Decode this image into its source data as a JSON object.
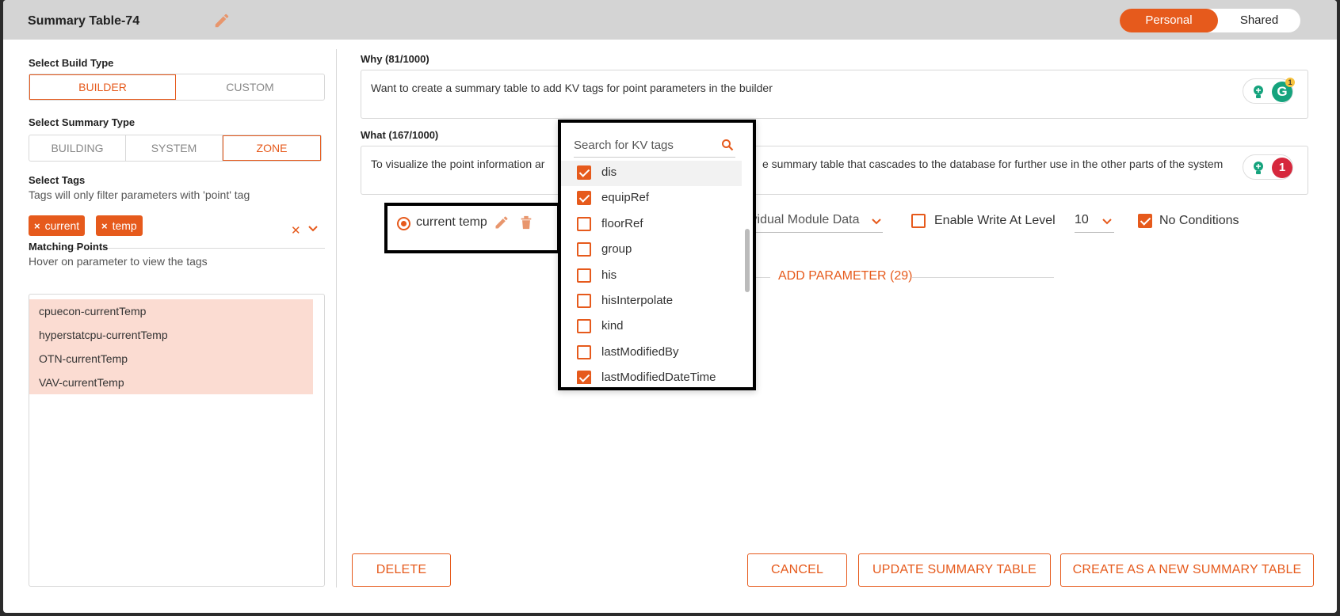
{
  "header": {
    "title": "Summary Table-74",
    "toggle": {
      "personal": "Personal",
      "shared": "Shared",
      "selected": "Personal"
    }
  },
  "left": {
    "build_type": {
      "label": "Select Build Type",
      "options": [
        "BUILDER",
        "CUSTOM"
      ],
      "selected": "BUILDER"
    },
    "summary_type": {
      "label": "Select Summary Type",
      "options": [
        "BUILDING",
        "SYSTEM",
        "ZONE"
      ],
      "selected": "ZONE"
    },
    "tags": {
      "label": "Select Tags",
      "hint": "Tags will only filter parameters with 'point' tag",
      "chips": [
        "current",
        "temp"
      ],
      "chip_remove": "×",
      "clear": "✕"
    },
    "matching_points": {
      "label": "Matching Points",
      "hint": "Hover on parameter to view the tags",
      "items": [
        "cpuecon-currentTemp",
        "hyperstatcpu-currentTemp",
        "OTN-currentTemp",
        "VAV-currentTemp"
      ]
    }
  },
  "right": {
    "why": {
      "label": "Why (81/1000)",
      "text": "Want to create a summary table to add KV tags for point parameters in the builder",
      "grammarly_badge": "1"
    },
    "what": {
      "label": "What (167/1000)",
      "text_start": "To visualize the point information ar",
      "text_end": "e summary table that cascades to the database for further use in the other parts of the system",
      "grammarly_count": "1"
    },
    "parameter": {
      "name": "current temp",
      "module_select": "ividual Module Data",
      "enable_write_label": "Enable Write At Level",
      "enable_write_checked": false,
      "level_value": "10",
      "no_conditions_label": "No Conditions",
      "no_conditions_checked": true
    },
    "add_parameter": "ADD PARAMETER (29)"
  },
  "kv_dropdown": {
    "search_placeholder": "Search for KV tags",
    "items": [
      {
        "label": "dis",
        "checked": true
      },
      {
        "label": "equipRef",
        "checked": true
      },
      {
        "label": "floorRef",
        "checked": false
      },
      {
        "label": "group",
        "checked": false
      },
      {
        "label": "his",
        "checked": false
      },
      {
        "label": "hisInterpolate",
        "checked": false
      },
      {
        "label": "kind",
        "checked": false
      },
      {
        "label": "lastModifiedBy",
        "checked": false
      },
      {
        "label": "lastModifiedDateTime",
        "checked": true
      }
    ]
  },
  "footer": {
    "delete": "DELETE",
    "cancel": "CANCEL",
    "update": "UPDATE SUMMARY TABLE",
    "create_new": "CREATE AS A NEW SUMMARY TABLE"
  },
  "colors": {
    "accent": "#e65a1c",
    "highlight": "#fbdcd2",
    "header_bg": "#d4d4d4"
  }
}
